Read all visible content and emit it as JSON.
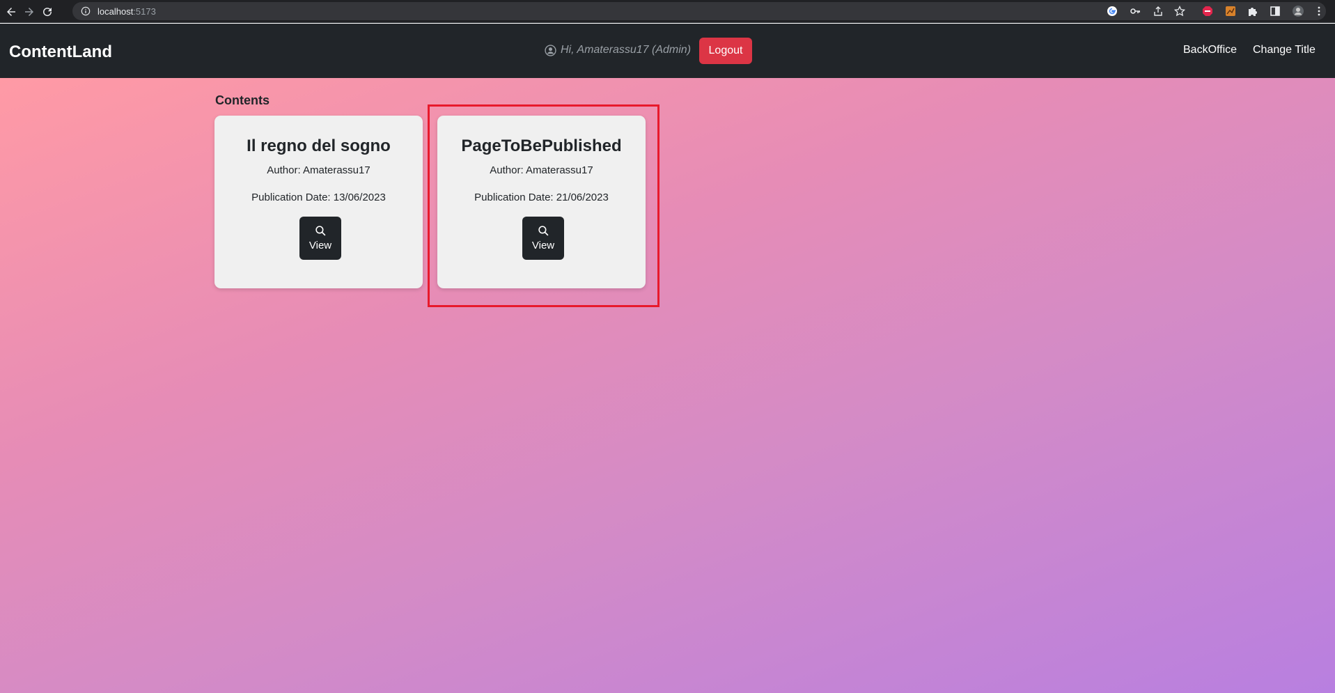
{
  "browser": {
    "url_host": "localhost",
    "url_port": ":5173"
  },
  "navbar": {
    "brand": "ContentLand",
    "greeting": "Hi, Amaterassu17 (Admin)",
    "logout_label": "Logout",
    "links": [
      "BackOffice",
      "Change Title"
    ]
  },
  "main": {
    "section_title": "Contents",
    "cards": [
      {
        "title": "Il regno del sogno",
        "author": "Author: Amaterassu17",
        "date": "Publication Date: 13/06/2023",
        "view_label": "View"
      },
      {
        "title": "PageToBePublished",
        "author": "Author: Amaterassu17",
        "date": "Publication Date: 21/06/2023",
        "view_label": "View"
      }
    ]
  },
  "colors": {
    "navbar_bg": "#212529",
    "logout_bg": "#dc3545",
    "highlight": "#e8192c"
  }
}
